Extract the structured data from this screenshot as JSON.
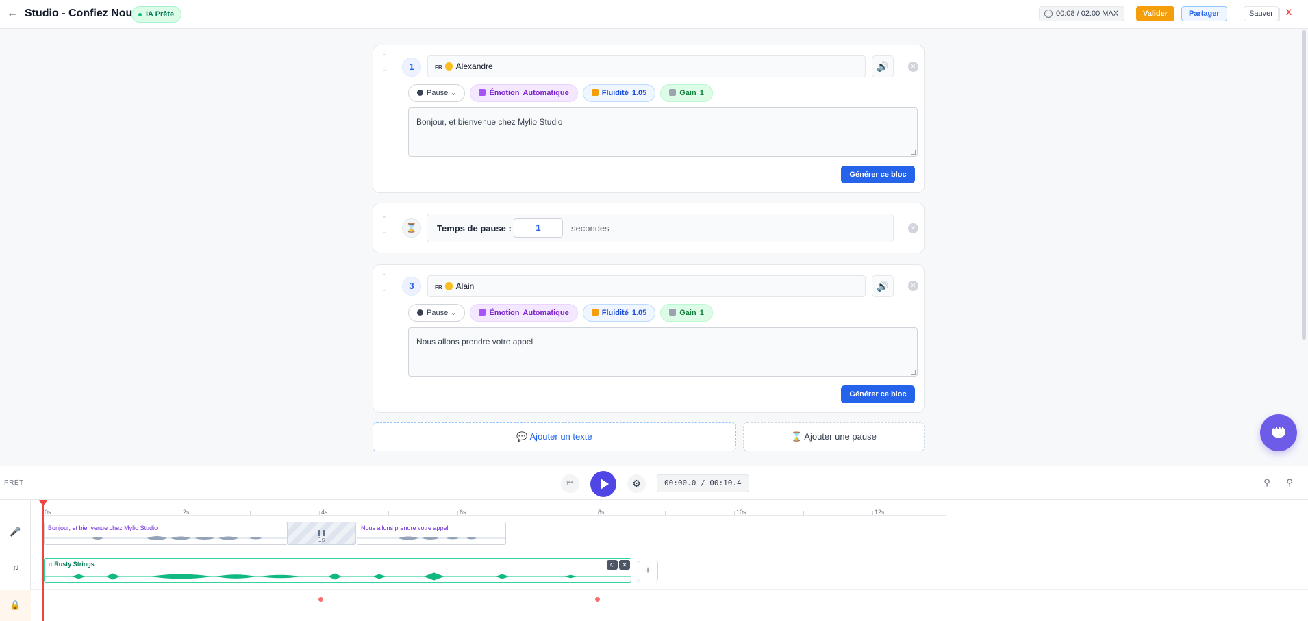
{
  "header": {
    "title": "Studio - Confiez Nous",
    "status_badge": "IA Prête",
    "timer": "00:08 / 02:00 MAX",
    "validate_label": "Valider",
    "share_label": "Partager",
    "save_label": "Sauver",
    "close_label": "X"
  },
  "blocks": [
    {
      "number": "1",
      "lang": "FR",
      "voice": "Alexandre",
      "pause_label": "Pause",
      "emotion_label": "Émotion",
      "emotion_value": "Automatique",
      "fluidity_label": "Fluidité",
      "fluidity_value": "1.05",
      "gain_label": "Gain",
      "gain_value": "1",
      "text": "Bonjour, et bienvenue chez Mylio Studio",
      "generate_label": "Générer ce bloc"
    },
    {
      "pause_label": "Temps de pause :",
      "pause_value": "1",
      "pause_unit": "secondes"
    },
    {
      "number": "3",
      "lang": "FR",
      "voice": "Alain",
      "pause_label": "Pause",
      "emotion_label": "Émotion",
      "emotion_value": "Automatique",
      "fluidity_label": "Fluidité",
      "fluidity_value": "1.05",
      "gain_label": "Gain",
      "gain_value": "1",
      "text": "Nous allons prendre votre appel",
      "generate_label": "Générer ce bloc"
    }
  ],
  "actions": {
    "add_text": "Ajouter un texte",
    "add_pause": "Ajouter une pause"
  },
  "transport": {
    "status": "PRÊT",
    "time": "00:00.0 / 00:10.4"
  },
  "timeline": {
    "ticks": [
      "0s",
      "2s",
      "4s",
      "6s",
      "8s",
      "10s",
      "12s"
    ],
    "voice_clips": [
      "Bonjour, et bienvenue chez Mylio Studio",
      "Nous allons prendre votre appel"
    ],
    "pause_clip": "1s",
    "music_clip": "Rusty Strings"
  },
  "colors": {
    "accent": "#2563eb",
    "play": "#4f46e5",
    "validate": "#f59e0b",
    "music": "#34d399",
    "playhead": "#ef4444"
  }
}
